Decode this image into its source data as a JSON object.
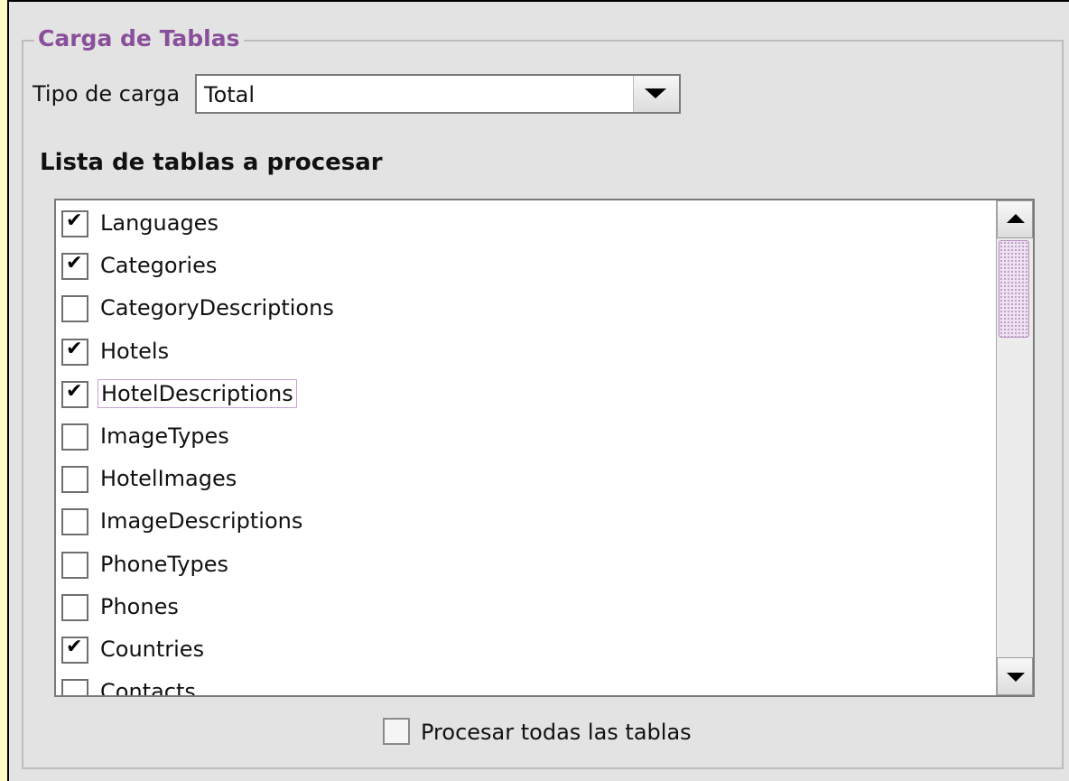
{
  "panel": {
    "title": "Carga de Tablas",
    "load_type_label": "Tipo de carga",
    "load_type_value": "Total",
    "list_title": "Lista de tablas a procesar",
    "tables": [
      {
        "name": "Languages",
        "checked": true
      },
      {
        "name": "Categories",
        "checked": true
      },
      {
        "name": "CategoryDescriptions",
        "checked": false
      },
      {
        "name": "Hotels",
        "checked": true
      },
      {
        "name": "HotelDescriptions",
        "checked": true,
        "focused": true
      },
      {
        "name": "ImageTypes",
        "checked": false
      },
      {
        "name": "HotelImages",
        "checked": false
      },
      {
        "name": "ImageDescriptions",
        "checked": false
      },
      {
        "name": "PhoneTypes",
        "checked": false
      },
      {
        "name": "Phones",
        "checked": false
      },
      {
        "name": "Countries",
        "checked": true
      },
      {
        "name": "Contacts",
        "checked": false
      }
    ],
    "process_all_label": "Procesar todas las tablas",
    "process_all_checked": false
  },
  "colors": {
    "background": "#fffcc4",
    "panel_bg": "#e3e3e3",
    "accent": "#8a4f9a"
  },
  "icons": {
    "combo_arrow": "chevron-down-icon",
    "scroll_up": "arrow-up-icon",
    "scroll_down": "arrow-down-icon",
    "check": "checkmark-icon"
  }
}
